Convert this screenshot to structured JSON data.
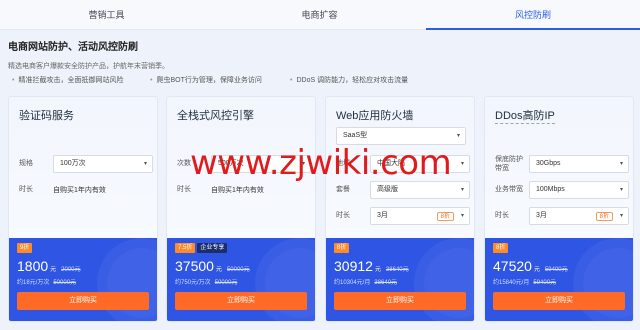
{
  "tabs": [
    "营销工具",
    "电商扩容",
    "风控防刷"
  ],
  "intro": {
    "title": "电商网站防护、活动风控防刷",
    "desc": "精选电商客户爆款安全防护产品，护航年末营销季。",
    "features": [
      "精准拦截攻击，全面抵御网站风险",
      "爬虫BOT行为管理，保障业务访问",
      "DDoS 调防能力，轻松应对攻击流量"
    ]
  },
  "cards": [
    {
      "title": "验证码服务",
      "rows": [
        {
          "label": "规格",
          "select": "100万次"
        },
        {
          "label": "时长",
          "value": "自购买1年内有效"
        }
      ],
      "badges": [
        "9折"
      ],
      "price": "1800",
      "unit": "元",
      "orig": "2000元",
      "sub": "约18元/万次",
      "sub_orig": "50000元",
      "buy": "立即购买"
    },
    {
      "title": "全栈式风控引擎",
      "rows": [
        {
          "label": "次数",
          "select": "500万次"
        },
        {
          "label": "时长",
          "value": "自购买1年内有效"
        }
      ],
      "badges": [
        "7.5折",
        "企业专享"
      ],
      "price": "37500",
      "unit": "元",
      "orig": "50000元",
      "sub": "约750元/万次",
      "sub_orig": "50000元",
      "buy": "立即购买"
    },
    {
      "title": "Web应用防火墙",
      "top_select": "SaaS型",
      "rows": [
        {
          "label": "地域",
          "select": "中国大陆"
        },
        {
          "label": "套餐",
          "select": "高级版"
        },
        {
          "label": "时长",
          "select": "3月",
          "discount": "8折"
        }
      ],
      "badges": [
        "8折"
      ],
      "price": "30912",
      "unit": "元",
      "orig": "38640元",
      "sub": "约10304元/月",
      "sub_orig": "38640元",
      "buy": "立即购买"
    },
    {
      "title": "DDos高防IP",
      "rows": [
        {
          "label": "保底防护带宽",
          "select": "30Gbps"
        },
        {
          "label": "业务带宽",
          "select": "100Mbps"
        },
        {
          "label": "时长",
          "select": "3月",
          "discount": "8折"
        }
      ],
      "badges": [
        "8折"
      ],
      "price": "47520",
      "unit": "元",
      "orig": "59400元",
      "sub": "约15840元/月",
      "sub_orig": "59400元",
      "buy": "立即购买"
    }
  ],
  "watermark": "www.zjwiki.com",
  "colors": {
    "accent": "#2b5fe0",
    "card_bottom": "#2f55e4",
    "buy": "#ff6a26",
    "badge": "#ff8a2a",
    "watermark": "#e11b1b"
  }
}
